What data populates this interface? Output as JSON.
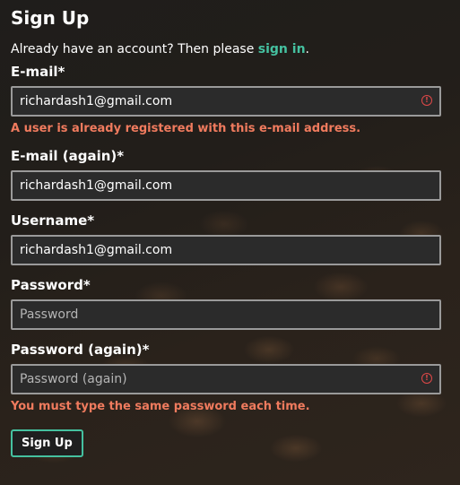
{
  "page": {
    "title": "Sign Up",
    "intro_text": "Already have an account? Then please ",
    "intro_link": "sign in",
    "intro_suffix": "."
  },
  "form": {
    "email": {
      "label": "E-mail*",
      "value": "richardash1@gmail.com",
      "error": "A user is already registered with this e-mail address."
    },
    "email_again": {
      "label": "E-mail (again)*",
      "value": "richardash1@gmail.com"
    },
    "username": {
      "label": "Username*",
      "value": "richardash1@gmail.com"
    },
    "password": {
      "label": "Password*",
      "placeholder": "Password",
      "value": ""
    },
    "password_again": {
      "label": "Password (again)*",
      "placeholder": "Password (again)",
      "value": "",
      "error": "You must type the same password each time."
    },
    "submit_label": "Sign Up"
  },
  "icons": {
    "error": "alert-circle-icon"
  },
  "colors": {
    "accent": "#45c1a0",
    "error_text": "#f07b5e",
    "error_icon": "#e04848",
    "input_bg": "#2b2b2b",
    "input_border": "#9a9a9a"
  }
}
